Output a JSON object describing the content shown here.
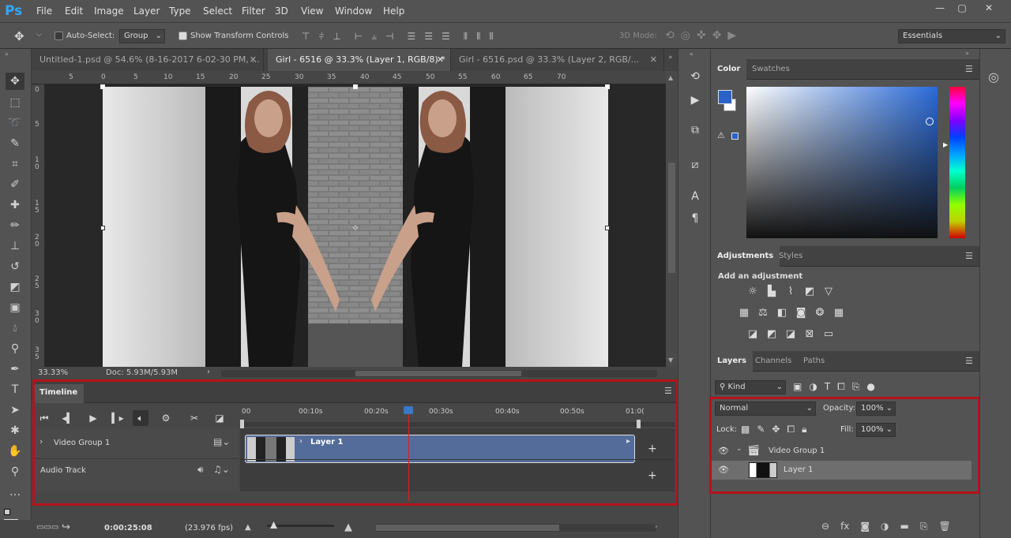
{
  "app": {
    "logo": "Ps",
    "menus": [
      "File",
      "Edit",
      "Image",
      "Layer",
      "Type",
      "Select",
      "Filter",
      "3D",
      "View",
      "Window",
      "Help"
    ],
    "window_controls": [
      "—",
      "▢",
      "✕"
    ]
  },
  "options": {
    "auto_select_label": "Auto-Select:",
    "auto_select_target": "Group",
    "show_transform_label": "Show Transform Controls",
    "mode_3d_label": "3D Mode:",
    "workspace": "Essentials"
  },
  "tabs": [
    {
      "label": "Untitled-1.psd @ 54.6% (8-16-2017 6-02-30 PM, ...",
      "close": "✕",
      "active": false
    },
    {
      "label": "Girl - 6516 @ 33.3% (Layer 1, RGB/8) *",
      "close": "✕",
      "active": true
    },
    {
      "label": "Girl - 6516.psd @ 33.3% (Layer 2, RGB/...",
      "close": "✕",
      "active": false
    }
  ],
  "rulers": {
    "top": [
      "5",
      "0",
      "5",
      "10",
      "15",
      "20",
      "25",
      "30",
      "35",
      "40",
      "45",
      "50",
      "55",
      "60",
      "65",
      "70"
    ],
    "left": [
      "0",
      "5",
      "1\n0",
      "1\n5",
      "2\n0",
      "2\n5",
      "3\n0",
      "3\n5"
    ]
  },
  "status": {
    "zoom": "33.33%",
    "doc": "Doc: 5.93M/5.93M",
    "arrow": "›"
  },
  "timeline": {
    "title": "Timeline",
    "times": [
      "00",
      "00:10s",
      "00:20s",
      "00:30s",
      "00:40s",
      "00:50s",
      "01:0("
    ],
    "tracks": [
      {
        "label": "Video Group 1",
        "chevron": "›"
      },
      {
        "label": "Audio Track"
      }
    ],
    "clip_label": "Layer 1",
    "current_time": "0:00:25:08",
    "fps": "(23.976 fps)",
    "playhead_fraction": 0.42
  },
  "panels": {
    "color": {
      "tabs": [
        "Color",
        "Swatches"
      ],
      "fg": "#2a62c9",
      "bg": "#ffffff"
    },
    "adjustments": {
      "tabs": [
        "Adjustments",
        "Styles"
      ],
      "hint": "Add an adjustment"
    },
    "layers": {
      "tabs": [
        "Layers",
        "Channels",
        "Paths"
      ],
      "filter": "Kind",
      "blend": "Normal",
      "opacity_label": "Opacity:",
      "opacity": "100%",
      "lock_label": "Lock:",
      "fill_label": "Fill:",
      "fill": "100%",
      "items": [
        {
          "name": "Video Group 1",
          "type": "group"
        },
        {
          "name": "Layer 1",
          "type": "layer"
        }
      ]
    }
  }
}
